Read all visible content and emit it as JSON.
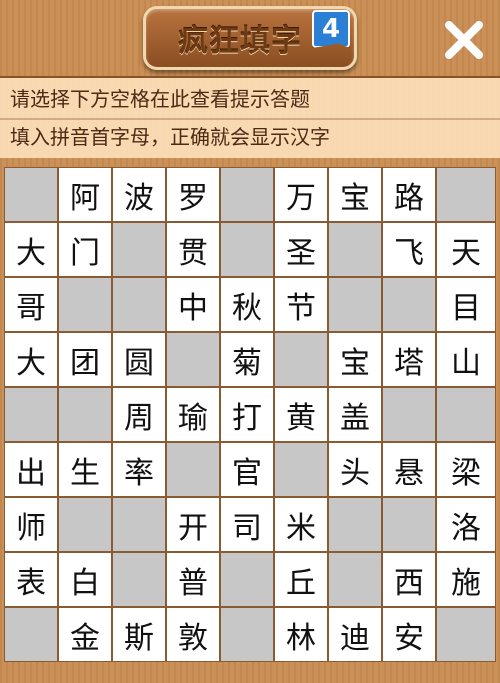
{
  "header": {
    "title": "疯狂填字",
    "level": "4",
    "close_icon": "close-icon"
  },
  "hint": {
    "line1": "请选择下方空格在此查看提示答题",
    "line2": "填入拼音首字母，正确就会显示汉字"
  },
  "board": {
    "rows": [
      [
        "",
        "阿",
        "波",
        "罗",
        "",
        "万",
        "宝",
        "路",
        ""
      ],
      [
        "大",
        "门",
        "",
        "贯",
        "",
        "圣",
        "",
        "飞",
        "天"
      ],
      [
        "哥",
        "",
        "",
        "中",
        "秋",
        "节",
        "",
        "",
        "目"
      ],
      [
        "大",
        "团",
        "圆",
        "",
        "菊",
        "",
        "宝",
        "塔",
        "山"
      ],
      [
        "",
        "",
        "周",
        "瑜",
        "打",
        "黄",
        "盖",
        "",
        ""
      ],
      [
        "出",
        "生",
        "率",
        "",
        "官",
        "",
        "头",
        "悬",
        "梁"
      ],
      [
        "师",
        "",
        "",
        "开",
        "司",
        "米",
        "",
        "",
        "洛"
      ],
      [
        "表",
        "白",
        "",
        "普",
        "",
        "丘",
        "",
        "西",
        "施"
      ],
      [
        "",
        "金",
        "斯",
        "敦",
        "",
        "林",
        "迪",
        "安",
        ""
      ]
    ],
    "colors": {
      "empty": "#c7c7c7",
      "filled": "#ffffff",
      "grid": "#8a5a30"
    }
  }
}
